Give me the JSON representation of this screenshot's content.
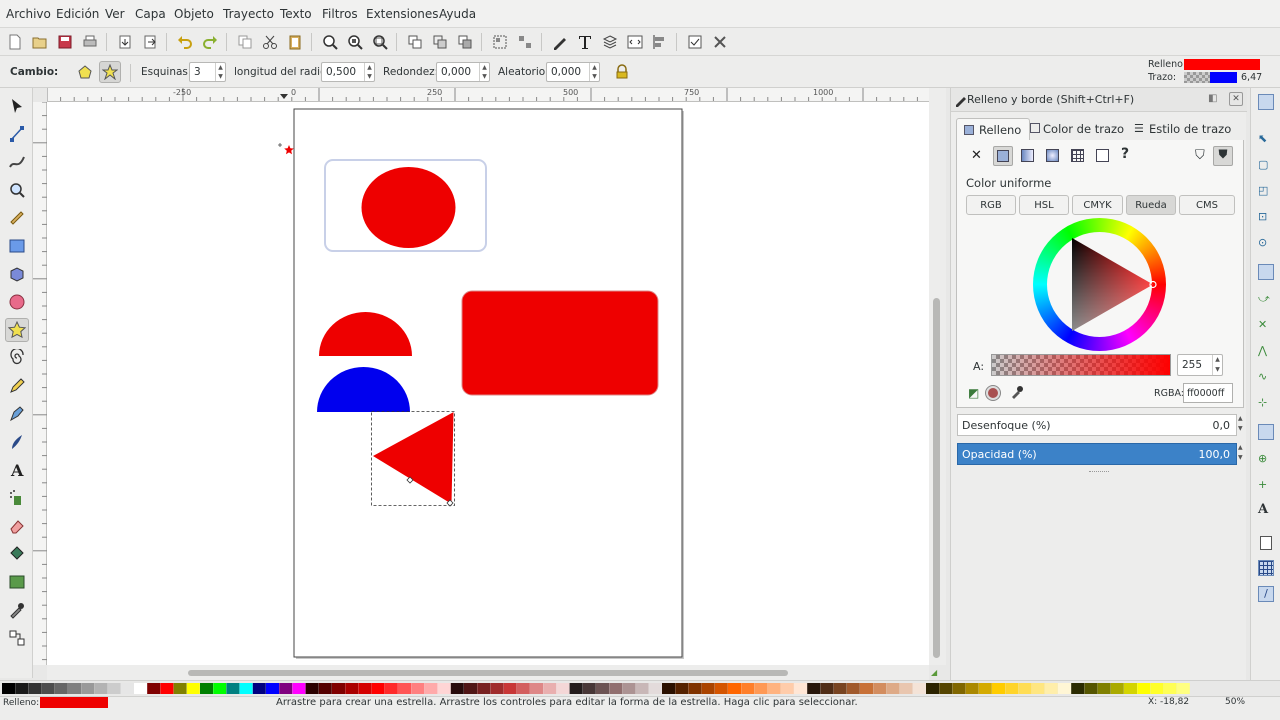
{
  "menu": [
    "Archivo",
    "Edición",
    "Ver",
    "Capa",
    "Objeto",
    "Trayecto",
    "Texto",
    "Filtros",
    "Extensiones",
    "Ayuda"
  ],
  "style_indicator": {
    "fill_label": "Relleno:",
    "stroke_label": "Trazo:",
    "stroke_width": "6,47",
    "fill_color": "#ff0000",
    "stroke_color": "#0000ff"
  },
  "tool_controls": {
    "mode_label": "Cambio:",
    "corners_label": "Esquinas:",
    "corners_value": "3",
    "ratio_label": "longitud del radio:",
    "ratio_value": "0,500",
    "rounded_label": "Redondez:",
    "rounded_value": "0,000",
    "random_label": "Aleatorio:",
    "random_value": "0,000"
  },
  "ruler_labels": [
    "-250",
    "0",
    "250",
    "500",
    "750",
    "1000"
  ],
  "panel": {
    "title": "Relleno y borde (Shift+Ctrl+F)",
    "tabs": [
      "Relleno",
      "Color de trazo",
      "Estilo de trazo"
    ],
    "paint_label": "Color uniforme",
    "modes": [
      "RGB",
      "HSL",
      "CMYK",
      "Rueda",
      "CMS"
    ],
    "active_mode": "Rueda",
    "alpha_label": "A:",
    "alpha_value": "255",
    "rgba_label": "RGBA:",
    "rgba_value": "ff0000ff",
    "blur_label": "Desenfoque (%)",
    "blur_value": "0,0",
    "opacity_label": "Opacidad (%)",
    "opacity_value": "100,0"
  },
  "status": {
    "fill_label": "Relleno:",
    "message": "Arrastre para crear una estrella. Arrastre los controles para editar la forma de la estrella. Haga clic para seleccionar.",
    "coords": "X: -18,82",
    "zoom": "50%"
  },
  "colors": {
    "red": "#ee0000",
    "blue": "#0000ee",
    "accent": "#3c82c8"
  }
}
